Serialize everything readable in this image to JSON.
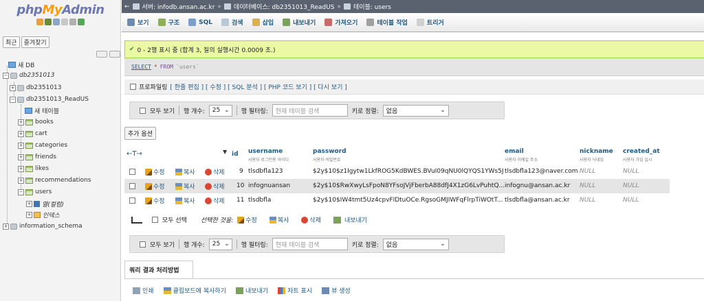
{
  "nav": {
    "logo_php": "php",
    "logo_my": "My",
    "logo_admin": "Admin",
    "tabs": [
      "최근",
      "즐겨찾기"
    ],
    "tree": {
      "new_db": "새 DB",
      "db_root": "db2351013",
      "db_child1": "db2351013",
      "db_child2": "db2351013_ReadUS",
      "new_table": "새 테이블",
      "tables": [
        "books",
        "cart",
        "categories",
        "friends",
        "likes",
        "recommendations",
        "users"
      ],
      "users_columns": "열(컬럼)",
      "users_index": "인덱스",
      "info_schema": "information_schema"
    }
  },
  "breadcrumb": {
    "server": "서버: infodb.ansan.ac.kr",
    "database": "데이터베이스: db2351013_ReadUS",
    "table": "테이블: users"
  },
  "menubar": {
    "items": [
      "보기",
      "구조",
      "SQL",
      "검색",
      "삽입",
      "내보내기",
      "가져오기",
      "테이블 작업",
      "트리거"
    ]
  },
  "result": {
    "success": "0 - 2행 표시 중 (합계 3, 질의 실행시간 0.0009 초.)",
    "sql_select": "SELECT",
    "sql_star": "*",
    "sql_from": "FROM",
    "sql_table": "`users`",
    "profiling": "프로파일링",
    "links": "[ 한줄 편집 ] [ 수정 ] [ SQL 분석 ] [ PHP 코드 보기 ] [ 다시 보기 ]"
  },
  "navbar": {
    "show_all": "모두 보기",
    "row_count_label": "행 개수:",
    "row_count": "25",
    "filter_label": "행 필터링:",
    "filter_placeholder": "현재 테이블 검색",
    "sort_label": "키로 정렬:",
    "sort_value": "없음"
  },
  "extra_options": "추가 옵션",
  "table": {
    "col_id": "id",
    "col_username": "username",
    "col_username_sub": "사용자 로그인용 아이디",
    "col_password": "password",
    "col_password_sub": "사용자 비밀번호",
    "col_email": "email",
    "col_email_sub": "사용자 이메일 주소",
    "col_nickname": "nickname",
    "col_nickname_sub": "사용자 닉네임",
    "col_created": "created_at",
    "col_created_sub": "사용자 가입 일시",
    "action_edit": "수정",
    "action_copy": "복사",
    "action_delete": "삭제",
    "rows": [
      {
        "id": "9",
        "username": "tlsdbfla123",
        "password": "$2y$10$z1Igytw1LkfROG5KdBWES.BVuI09qNU0lQYQS1YWs5J...",
        "email": "tlsdbfla123@naver.com",
        "nickname": "NULL",
        "created_at": "NULL"
      },
      {
        "id": "10",
        "username": "infognuansan",
        "password": "$2y$10$RwXwyLsFpoN8YFsoJVjFberbA88dfJ4X1zG6LvPuhtQ...",
        "email": "infognu@ansan.ac.kr",
        "nickname": "NULL",
        "created_at": "NULL"
      },
      {
        "id": "11",
        "username": "tlsdbfla",
        "password": "$2y$10$IW4tmt5Uz4cpvFlDtuOCe.RgsoGMJIWFqFlrpTiWOtT...",
        "email": "tlsdbfla@ansan.ac.kr",
        "nickname": "NULL",
        "created_at": "NULL"
      }
    ]
  },
  "bulk": {
    "check_all": "모두 선택",
    "with_selected": "선택한 것을:",
    "edit": "수정",
    "copy": "복사",
    "delete": "삭제",
    "export": "내보내기"
  },
  "ops": {
    "title": "쿼리 결과 처리방법",
    "print": "인쇄",
    "clipboard": "클립보드에 복사하기",
    "export": "내보내기",
    "chart": "차트 표시",
    "view": "뷰 생성"
  },
  "colors": {
    "link": "#235a81",
    "success_bg": "#ebf8a4",
    "crumb_bg": "#5a6270"
  }
}
